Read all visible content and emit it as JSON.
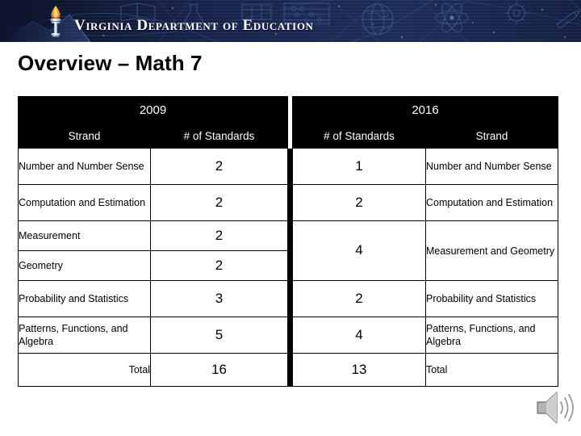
{
  "banner": {
    "org_name": "Virginia Department of Education",
    "logo_icon": "torch-icon",
    "bg_color": "#16213f",
    "text_color": "#ffffff"
  },
  "slide": {
    "title": "Overview – Math 7"
  },
  "table": {
    "header_bg": "#000000",
    "header_fg": "#ffffff",
    "year_left": "2009",
    "year_right": "2016",
    "columns": [
      "Strand",
      "# of Standards",
      "# of Standards",
      "Strand"
    ],
    "rows": [
      {
        "left_strand": "Number and Number Sense",
        "left_count": "2",
        "right_count": "1",
        "right_strand": "Number and Number Sense"
      },
      {
        "left_strand": "Computation and Estimation",
        "left_count": "2",
        "right_count": "2",
        "right_strand": "Computation and Estimation"
      },
      {
        "left_strand": "Measurement",
        "left_count": "2",
        "right_count": "4",
        "right_strand": "Measurement and Geometry"
      },
      {
        "left_strand": "Geometry",
        "left_count": "2"
      },
      {
        "left_strand": "Probability and Statistics",
        "left_count": "3",
        "right_count": "2",
        "right_strand": "Probability and Statistics"
      },
      {
        "left_strand": "Patterns, Functions, and Algebra",
        "left_count": "5",
        "right_count": "4",
        "right_strand": "Patterns, Functions, and Algebra"
      }
    ],
    "total": {
      "left_label": "Total",
      "left_count": "16",
      "right_count": "13",
      "right_label": "Total"
    }
  },
  "media": {
    "audio_icon": "speaker-icon"
  }
}
